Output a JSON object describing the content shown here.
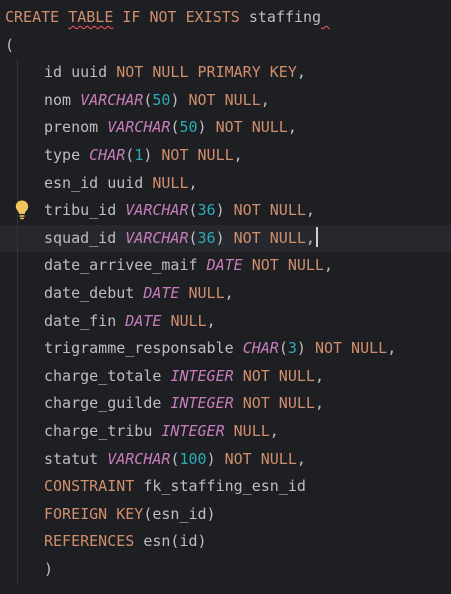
{
  "editor": {
    "lines": [
      {
        "tokens": [
          {
            "t": "CREATE",
            "c": "kw"
          },
          {
            "t": " ",
            "c": "punct"
          },
          {
            "t": "TABLE",
            "c": "kw squiggle"
          },
          {
            "t": " ",
            "c": "punct"
          },
          {
            "t": "IF",
            "c": "kw"
          },
          {
            "t": " ",
            "c": "punct"
          },
          {
            "t": "NOT",
            "c": "kw"
          },
          {
            "t": " ",
            "c": "punct"
          },
          {
            "t": "EXISTS",
            "c": "kw"
          },
          {
            "t": " staffing",
            "c": "id"
          },
          {
            "t": " ",
            "c": "id squiggle"
          }
        ],
        "indent": false
      },
      {
        "tokens": [
          {
            "t": "(",
            "c": "punct"
          }
        ],
        "indent": false
      },
      {
        "tokens": [
          {
            "t": "id uuid ",
            "c": "id"
          },
          {
            "t": "NOT NULL PRIMARY KEY",
            "c": "kw"
          },
          {
            "t": ",",
            "c": "punct"
          }
        ],
        "indent": true
      },
      {
        "tokens": [
          {
            "t": "nom ",
            "c": "id"
          },
          {
            "t": "VARCHAR",
            "c": "typ"
          },
          {
            "t": "(",
            "c": "punct"
          },
          {
            "t": "50",
            "c": "num"
          },
          {
            "t": ") ",
            "c": "punct"
          },
          {
            "t": "NOT NULL",
            "c": "kw"
          },
          {
            "t": ",",
            "c": "punct"
          }
        ],
        "indent": true
      },
      {
        "tokens": [
          {
            "t": "prenom ",
            "c": "id"
          },
          {
            "t": "VARCHAR",
            "c": "typ"
          },
          {
            "t": "(",
            "c": "punct"
          },
          {
            "t": "50",
            "c": "num"
          },
          {
            "t": ") ",
            "c": "punct"
          },
          {
            "t": "NOT NULL",
            "c": "kw"
          },
          {
            "t": ",",
            "c": "punct"
          }
        ],
        "indent": true
      },
      {
        "tokens": [
          {
            "t": "type ",
            "c": "id"
          },
          {
            "t": "CHAR",
            "c": "typ"
          },
          {
            "t": "(",
            "c": "punct"
          },
          {
            "t": "1",
            "c": "num"
          },
          {
            "t": ") ",
            "c": "punct"
          },
          {
            "t": "NOT NULL",
            "c": "kw"
          },
          {
            "t": ",",
            "c": "punct"
          }
        ],
        "indent": true
      },
      {
        "tokens": [
          {
            "t": "esn_id uuid ",
            "c": "id"
          },
          {
            "t": "NULL",
            "c": "kw"
          },
          {
            "t": ",",
            "c": "punct"
          }
        ],
        "indent": true
      },
      {
        "tokens": [
          {
            "t": "tribu_id ",
            "c": "id"
          },
          {
            "t": "VARCHAR",
            "c": "typ"
          },
          {
            "t": "(",
            "c": "punct"
          },
          {
            "t": "36",
            "c": "num"
          },
          {
            "t": ") ",
            "c": "punct"
          },
          {
            "t": "NOT NULL",
            "c": "kw"
          },
          {
            "t": ",",
            "c": "punct"
          }
        ],
        "indent": true,
        "bulb": true
      },
      {
        "tokens": [
          {
            "t": "squad_id ",
            "c": "id"
          },
          {
            "t": "VARCHAR",
            "c": "typ"
          },
          {
            "t": "(",
            "c": "punct"
          },
          {
            "t": "36",
            "c": "num"
          },
          {
            "t": ") ",
            "c": "punct"
          },
          {
            "t": "NOT NULL",
            "c": "kw"
          },
          {
            "t": ",",
            "c": "punct"
          }
        ],
        "indent": true,
        "current": true,
        "caret": true
      },
      {
        "tokens": [
          {
            "t": "date_arrivee_maif ",
            "c": "id"
          },
          {
            "t": "DATE",
            "c": "typ"
          },
          {
            "t": " ",
            "c": "punct"
          },
          {
            "t": "NOT NULL",
            "c": "kw"
          },
          {
            "t": ",",
            "c": "punct"
          }
        ],
        "indent": true
      },
      {
        "tokens": [
          {
            "t": "date_debut ",
            "c": "id"
          },
          {
            "t": "DATE",
            "c": "typ"
          },
          {
            "t": " ",
            "c": "punct"
          },
          {
            "t": "NULL",
            "c": "kw"
          },
          {
            "t": ",",
            "c": "punct"
          }
        ],
        "indent": true
      },
      {
        "tokens": [
          {
            "t": "date_fin ",
            "c": "id"
          },
          {
            "t": "DATE",
            "c": "typ"
          },
          {
            "t": " ",
            "c": "punct"
          },
          {
            "t": "NULL",
            "c": "kw"
          },
          {
            "t": ",",
            "c": "punct"
          }
        ],
        "indent": true
      },
      {
        "tokens": [
          {
            "t": "trigramme_responsable ",
            "c": "id"
          },
          {
            "t": "CHAR",
            "c": "typ"
          },
          {
            "t": "(",
            "c": "punct"
          },
          {
            "t": "3",
            "c": "num"
          },
          {
            "t": ") ",
            "c": "punct"
          },
          {
            "t": "NOT NULL",
            "c": "kw"
          },
          {
            "t": ",",
            "c": "punct"
          }
        ],
        "indent": true
      },
      {
        "tokens": [
          {
            "t": "charge_totale ",
            "c": "id"
          },
          {
            "t": "INTEGER",
            "c": "typ"
          },
          {
            "t": " ",
            "c": "punct"
          },
          {
            "t": "NOT NULL",
            "c": "kw"
          },
          {
            "t": ",",
            "c": "punct"
          }
        ],
        "indent": true
      },
      {
        "tokens": [
          {
            "t": "charge_guilde ",
            "c": "id"
          },
          {
            "t": "INTEGER",
            "c": "typ"
          },
          {
            "t": " ",
            "c": "punct"
          },
          {
            "t": "NOT NULL",
            "c": "kw"
          },
          {
            "t": ",",
            "c": "punct"
          }
        ],
        "indent": true
      },
      {
        "tokens": [
          {
            "t": "charge_tribu ",
            "c": "id"
          },
          {
            "t": "INTEGER",
            "c": "typ"
          },
          {
            "t": " ",
            "c": "punct"
          },
          {
            "t": "NULL",
            "c": "kw"
          },
          {
            "t": ",",
            "c": "punct"
          }
        ],
        "indent": true
      },
      {
        "tokens": [
          {
            "t": "statut ",
            "c": "id"
          },
          {
            "t": "VARCHAR",
            "c": "typ"
          },
          {
            "t": "(",
            "c": "punct"
          },
          {
            "t": "100",
            "c": "num"
          },
          {
            "t": ") ",
            "c": "punct"
          },
          {
            "t": "NOT NULL",
            "c": "kw"
          },
          {
            "t": ",",
            "c": "punct"
          }
        ],
        "indent": true
      },
      {
        "tokens": [
          {
            "t": "CONSTRAINT",
            "c": "kw"
          },
          {
            "t": " fk_staffing_esn_id",
            "c": "id"
          }
        ],
        "indent": true
      },
      {
        "tokens": [
          {
            "t": "FOREIGN KEY",
            "c": "kw"
          },
          {
            "t": "(esn_id)",
            "c": "id"
          }
        ],
        "indent": true
      },
      {
        "tokens": [
          {
            "t": "REFERENCES",
            "c": "kw"
          },
          {
            "t": " esn(id)",
            "c": "id"
          }
        ],
        "indent": true
      },
      {
        "tokens": [
          {
            "t": ")",
            "c": "punct"
          }
        ],
        "indent": true
      }
    ],
    "icons": {
      "gutter_bulb": "lightbulb-icon"
    },
    "colors": {
      "background": "#1e1f22",
      "current_line": "#26282e",
      "keyword": "#cf8e6d",
      "type": "#c77dbb",
      "number": "#2aacb8",
      "identifier": "#bcbec4",
      "bulb": "#f2c55c",
      "error_squiggle": "#f75464"
    }
  }
}
